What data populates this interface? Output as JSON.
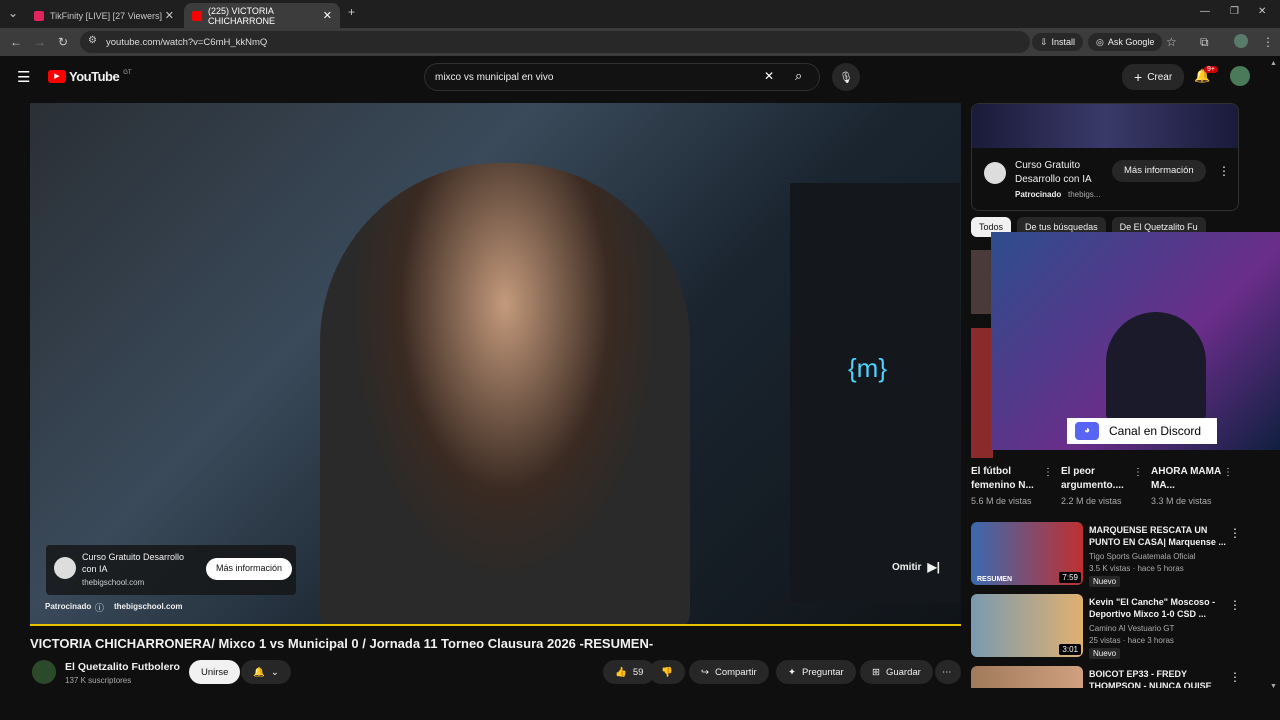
{
  "tabs": [
    {
      "title": "TikFinity [LIVE] [27 Viewers]"
    },
    {
      "title": "(225) VICTORIA CHICHARRONE"
    }
  ],
  "address": {
    "url": "youtube.com/watch?v=C6mH_kkNmQ",
    "install": "Install",
    "ask_google": "Ask Google"
  },
  "header": {
    "logo": "YouTube",
    "country": "GT",
    "search_value": "mixco vs municipal en vivo",
    "create": "Crear",
    "notifications": "9+"
  },
  "video_ad": {
    "title": "Curso Gratuito Desarrollo con IA",
    "domain": "thebigschool.com",
    "cta": "Más información",
    "sponsored": "Patrocinado",
    "sponsor_domain": "thebigschool.com",
    "skip": "Omitir",
    "monitor_text": "{m}"
  },
  "video": {
    "title": "VICTORIA CHICHARRONERA/ Mixco 1 vs Municipal 0 / Jornada 11 Torneo Clausura 2026 -RESUMEN-",
    "channel": "El Quetzalito Futbolero",
    "subscribers": "137 K suscriptores",
    "join": "Unirse",
    "likes": "59",
    "share": "Compartir",
    "ask": "Preguntar",
    "save": "Guardar"
  },
  "sidebar_ad": {
    "title": "Curso Gratuito Desarrollo con IA",
    "cta": "Más información",
    "sponsored": "Patrocinado",
    "domain": "thebigs..."
  },
  "chips": [
    "Todos",
    "De tus búsquedas",
    "De El Quetzalito Fu"
  ],
  "overlay": {
    "discord": "Canal en Discord"
  },
  "shorts": [
    {
      "title": "El fútbol femenino N...",
      "views": "5.6 M de vistas"
    },
    {
      "title": "El peor argumento....",
      "views": "2.2 M de vistas"
    },
    {
      "title": "AHORA MAMA MA...",
      "views": "3.3 M de vistas"
    }
  ],
  "related": [
    {
      "title": "MARQUENSE RESCATA UN PUNTO EN CASA| Marquense ...",
      "channel": "Tigo Sports Guatemala Oficial",
      "meta": "3.5 K vistas · hace 5 horas",
      "badge": "Nuevo",
      "duration": "7:59",
      "thumb_label": "RESUMEN"
    },
    {
      "title": "Kevin \"El Canche\" Moscoso - Deportivo Mixco 1-0 CSD ...",
      "channel": "Camino Al Vestuario GT",
      "meta": "25 vistas · hace 3 horas",
      "badge": "Nuevo",
      "duration": "3:01"
    },
    {
      "title": "BOICOT EP33 - FREDY THOMPSON - NUNCA QUISE",
      "channel": "",
      "meta": "",
      "badge": "",
      "duration": ""
    }
  ]
}
